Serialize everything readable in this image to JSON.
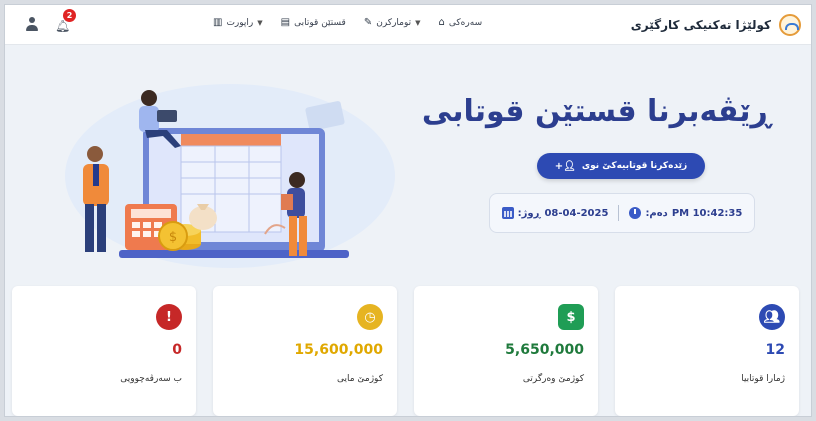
{
  "brand": {
    "name": "کولێژا تەکنیکی کارگێری"
  },
  "nav": {
    "menu": [
      {
        "label": "سەرەکی",
        "icon": "home-icon",
        "glyph": "⌂",
        "caret": false
      },
      {
        "label": "تومارکرن",
        "icon": "edit-icon",
        "glyph": "✎",
        "caret": true
      },
      {
        "label": "قستێن قوتابی",
        "icon": "table-icon",
        "glyph": "▤",
        "caret": false
      },
      {
        "label": "راپورت",
        "icon": "bar-chart-icon",
        "glyph": "▥",
        "caret": true
      }
    ],
    "notification_count": "2"
  },
  "hero": {
    "title": "ڕێڤەبرنا قستێن قوتابی",
    "add_button": "زێدەکرنا قوتابیەکێ نوی",
    "date_label": "ڕوژ:",
    "date_value": "08-04-2025",
    "time_label": "دەم:",
    "time_value": "PM 10:42:35"
  },
  "stats": [
    {
      "label": "ژمارا قوتابیا",
      "value": "12",
      "icon": "users-icon",
      "color": "#2d4ab3",
      "bg": "#2d4ab3"
    },
    {
      "label": "کوژمێ وەرگرتی",
      "value": "5,650,000",
      "icon": "money-icon",
      "color": "#1f7a3c",
      "bg": "#1f9d55"
    },
    {
      "label": "کوژمێ مایی",
      "value": "15,600,000",
      "icon": "clock-icon",
      "color": "#e0a800",
      "bg": "#e6b422"
    },
    {
      "label": "ب سەرڤەچوویی",
      "value": "0",
      "icon": "alert-icon",
      "color": "#c62828",
      "bg": "#c62828"
    }
  ]
}
